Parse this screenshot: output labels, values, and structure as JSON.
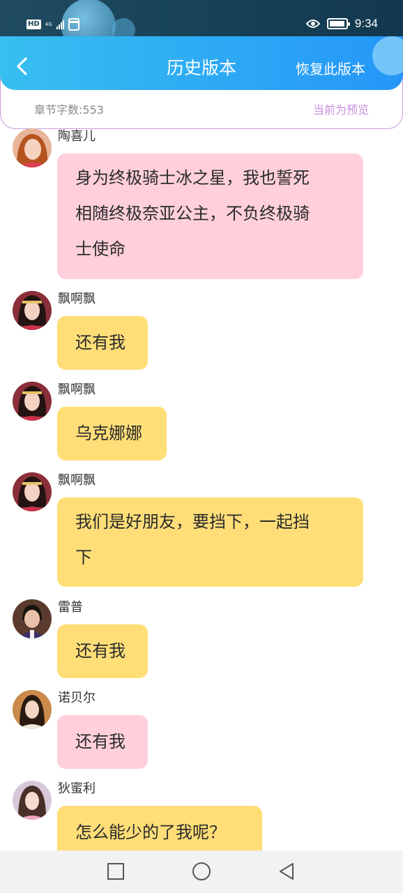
{
  "status_bar": {
    "hd": "HD",
    "network": "4G",
    "time": "9:34"
  },
  "header": {
    "title": "历史版本",
    "restore_label": "恢复此版本",
    "word_count": "章节字数:553",
    "preview_note": "当前为预览"
  },
  "messages": [
    {
      "sender": "陶喜儿",
      "lines": [
        "身为终极骑士冰之星，我也誓死",
        "相随终极奈亚公主，不负终极骑",
        "士使命"
      ],
      "color": "pink"
    },
    {
      "sender": "飘啊飘",
      "lines": [
        "还有我"
      ],
      "color": "yellow"
    },
    {
      "sender": "飘啊飘",
      "lines": [
        "乌克娜娜"
      ],
      "color": "yellow"
    },
    {
      "sender": "飘啊飘",
      "lines": [
        "我们是好朋友，要挡下，一起挡",
        "下"
      ],
      "color": "yellow"
    },
    {
      "sender": "雷普",
      "lines": [
        "还有我"
      ],
      "color": "yellow"
    },
    {
      "sender": "诺贝尔",
      "lines": [
        "还有我"
      ],
      "color": "pink"
    },
    {
      "sender": "狄蜜利",
      "lines": [
        "怎么能少的了我呢？"
      ],
      "color": "yellow"
    }
  ],
  "colors": {
    "header_blue": "#2ca7f5",
    "bubble_pink": "#ffd0db",
    "bubble_yellow": "#ffde78",
    "accent_purple": "#c78ee0"
  }
}
